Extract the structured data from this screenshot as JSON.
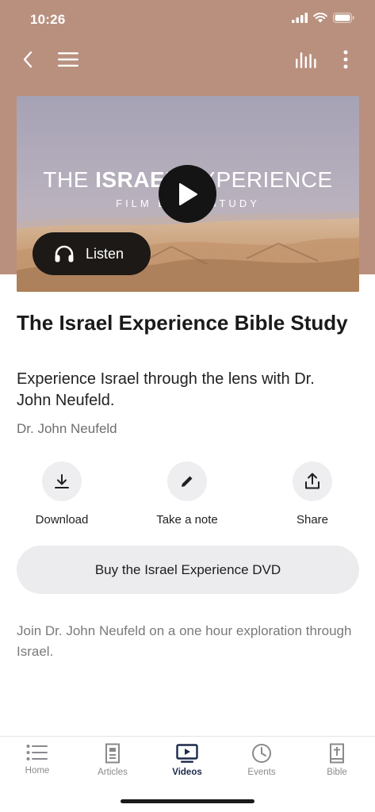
{
  "status_bar": {
    "time": "10:26",
    "signal_icon": "cellular-signal-icon",
    "wifi_icon": "wifi-icon",
    "battery_icon": "battery-icon"
  },
  "nav": {
    "back_icon": "chevron-left-icon",
    "menu_icon": "hamburger-menu-icon",
    "stats_icon": "bar-chart-icon",
    "more_icon": "more-vertical-icon"
  },
  "colors": {
    "hero_background": "#b9907e",
    "accent_active": "#1b2a4a"
  },
  "video": {
    "title_light_1": "THE ",
    "title_bold": "ISRAEL",
    "title_light_2": " EXPERIENCE",
    "subtitle": "FILM BIBLE STUDY",
    "play_icon": "play-icon",
    "listen_label": "Listen",
    "listen_icon": "headphones-icon"
  },
  "content": {
    "title": "The Israel Experience Bible Study",
    "subtitle": "Experience Israel through the lens with Dr. John Neufeld.",
    "author": "Dr. John Neufeld",
    "actions": [
      {
        "label": "Download",
        "icon": "download-icon"
      },
      {
        "label": "Take a note",
        "icon": "pencil-icon"
      },
      {
        "label": "Share",
        "icon": "share-icon"
      }
    ],
    "buy_button": "Buy the Israel Experience DVD",
    "description": "Join Dr. John Neufeld on a one hour exploration through Israel."
  },
  "tabs": [
    {
      "label": "Home",
      "icon": "list-icon",
      "active": false
    },
    {
      "label": "Articles",
      "icon": "article-icon",
      "active": false
    },
    {
      "label": "Videos",
      "icon": "video-icon",
      "active": true
    },
    {
      "label": "Events",
      "icon": "clock-icon",
      "active": false
    },
    {
      "label": "Bible",
      "icon": "bible-icon",
      "active": false
    }
  ]
}
